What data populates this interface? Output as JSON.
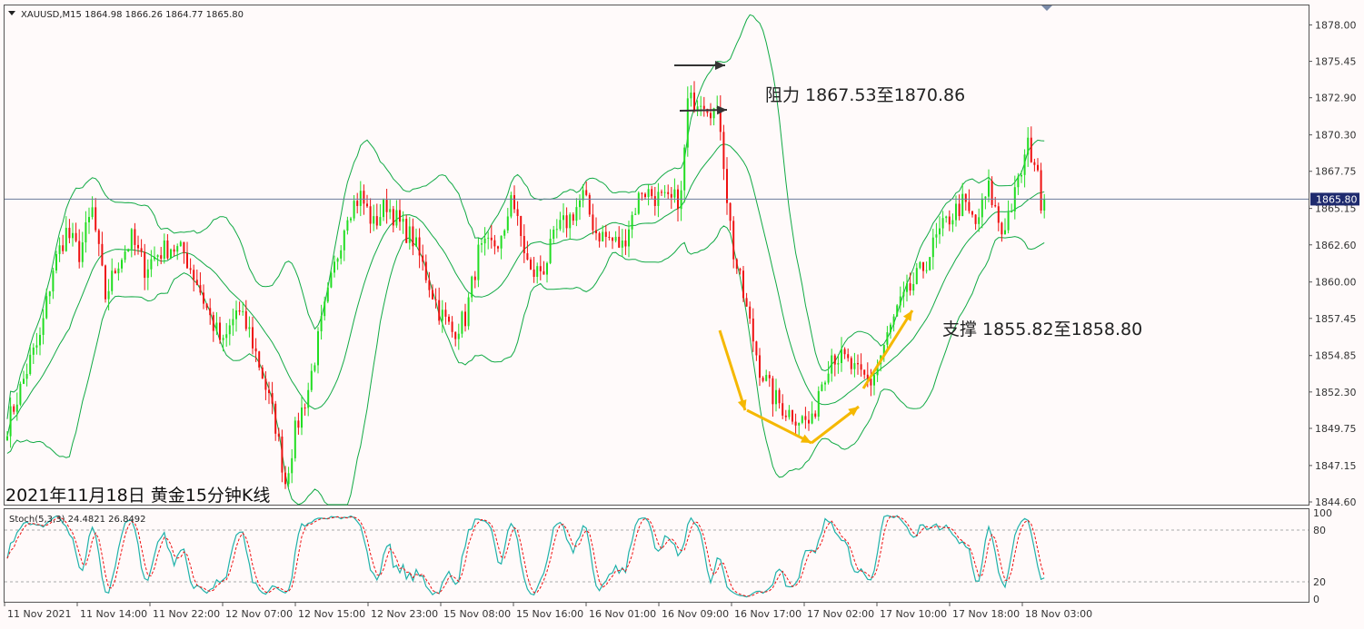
{
  "main_panel": {
    "info_line": "XAUUSD,M15  1864.98 1866.26 1864.77 1865.80",
    "current_price_label": "1865.80",
    "current_price": 1865.8,
    "annotations": {
      "resistance": "阻力 1867.53至1870.86",
      "support": "支撑 1855.82至1858.80",
      "caption": "2021年11月18日 黄金15分钟K线"
    }
  },
  "stoch_panel": {
    "info_line": "Stoch(5,3,3) 24.4821 26.8492",
    "ticks": [
      "100",
      "80",
      "20",
      "0"
    ]
  },
  "colors": {
    "background": "#fffafa",
    "bull": "#22dd22",
    "bear": "#ee1111",
    "bands": "#11aa44",
    "stoch_main": "#20b2aa",
    "stoch_signal": "#ee1111",
    "arrow": "#f5b800",
    "flag_arrow": "#333333",
    "price_line": "#6a7a9a"
  },
  "chart_data": {
    "type": "candlestick",
    "symbol": "XAUUSD",
    "timeframe": "M15",
    "ylim": [
      1844.6,
      1878.6
    ],
    "y_ticks": [
      "1878.00",
      "1875.45",
      "1872.90",
      "1870.30",
      "1867.75",
      "1865.15",
      "1862.60",
      "1860.00",
      "1857.45",
      "1854.85",
      "1852.30",
      "1849.75",
      "1847.15",
      "1844.60"
    ],
    "x_ticks": [
      "11 Nov 2021",
      "11 Nov 14:00",
      "11 Nov 22:00",
      "12 Nov 07:00",
      "12 Nov 15:00",
      "12 Nov 23:00",
      "15 Nov 08:00",
      "15 Nov 16:00",
      "16 Nov 01:00",
      "16 Nov 09:00",
      "16 Nov 17:00",
      "17 Nov 02:00",
      "17 Nov 10:00",
      "17 Nov 18:00",
      "18 Nov 03:00"
    ],
    "price_path": [
      [
        0,
        1850.0
      ],
      [
        4,
        1852.5
      ],
      [
        7,
        1854.5
      ],
      [
        10,
        1856.0
      ],
      [
        14,
        1861.0
      ],
      [
        18,
        1863.5
      ],
      [
        22,
        1862.0
      ],
      [
        26,
        1865.0
      ],
      [
        30,
        1859.0
      ],
      [
        34,
        1861.5
      ],
      [
        38,
        1863.0
      ],
      [
        42,
        1861.0
      ],
      [
        46,
        1862.0
      ],
      [
        50,
        1862.5
      ],
      [
        54,
        1862.0
      ],
      [
        58,
        1860.0
      ],
      [
        62,
        1857.5
      ],
      [
        66,
        1855.5
      ],
      [
        70,
        1858.0
      ],
      [
        74,
        1856.5
      ],
      [
        78,
        1853.5
      ],
      [
        82,
        1850.0
      ],
      [
        85,
        1846.0
      ],
      [
        88,
        1849.5
      ],
      [
        92,
        1852.5
      ],
      [
        96,
        1857.0
      ],
      [
        100,
        1861.0
      ],
      [
        104,
        1865.0
      ],
      [
        108,
        1866.0
      ],
      [
        112,
        1864.0
      ],
      [
        116,
        1865.5
      ],
      [
        120,
        1864.0
      ],
      [
        124,
        1863.0
      ],
      [
        128,
        1860.5
      ],
      [
        132,
        1858.0
      ],
      [
        136,
        1856.5
      ],
      [
        140,
        1857.5
      ],
      [
        144,
        1862.0
      ],
      [
        148,
        1862.5
      ],
      [
        152,
        1863.0
      ],
      [
        154,
        1866.5
      ],
      [
        156,
        1864.0
      ],
      [
        160,
        1860.5
      ],
      [
        164,
        1861.0
      ],
      [
        168,
        1863.5
      ],
      [
        172,
        1864.5
      ],
      [
        176,
        1866.0
      ],
      [
        180,
        1863.5
      ],
      [
        184,
        1863.0
      ],
      [
        188,
        1862.5
      ],
      [
        190,
        1864.0
      ],
      [
        194,
        1866.5
      ],
      [
        198,
        1866.0
      ],
      [
        202,
        1865.5
      ],
      [
        206,
        1866.0
      ],
      [
        208,
        1872.5
      ],
      [
        212,
        1873.0
      ],
      [
        216,
        1872.0
      ],
      [
        218,
        1871.0
      ],
      [
        220,
        1866.0
      ],
      [
        222,
        1862.0
      ],
      [
        226,
        1858.0
      ],
      [
        230,
        1854.0
      ],
      [
        234,
        1852.0
      ],
      [
        238,
        1851.0
      ],
      [
        242,
        1850.5
      ],
      [
        246,
        1850.0
      ],
      [
        248,
        1852.5
      ],
      [
        252,
        1855.0
      ],
      [
        256,
        1854.5
      ],
      [
        260,
        1853.5
      ],
      [
        264,
        1853.0
      ],
      [
        268,
        1855.5
      ],
      [
        272,
        1858.0
      ],
      [
        276,
        1859.5
      ],
      [
        280,
        1861.0
      ],
      [
        284,
        1863.0
      ],
      [
        288,
        1864.5
      ],
      [
        292,
        1865.5
      ],
      [
        296,
        1864.0
      ],
      [
        300,
        1866.5
      ],
      [
        304,
        1863.5
      ],
      [
        308,
        1866.0
      ],
      [
        312,
        1869.5
      ],
      [
        314,
        1868.5
      ],
      [
        316,
        1865.8
      ]
    ],
    "last_close": 1865.8,
    "bands": {
      "period": 20,
      "deviations": 2
    },
    "stochastic": {
      "k": 5,
      "d": 3,
      "slowing": 3,
      "main": 24.4821,
      "signal": 26.8492,
      "levels": [
        80,
        20
      ],
      "ylim": [
        0,
        100
      ]
    }
  }
}
